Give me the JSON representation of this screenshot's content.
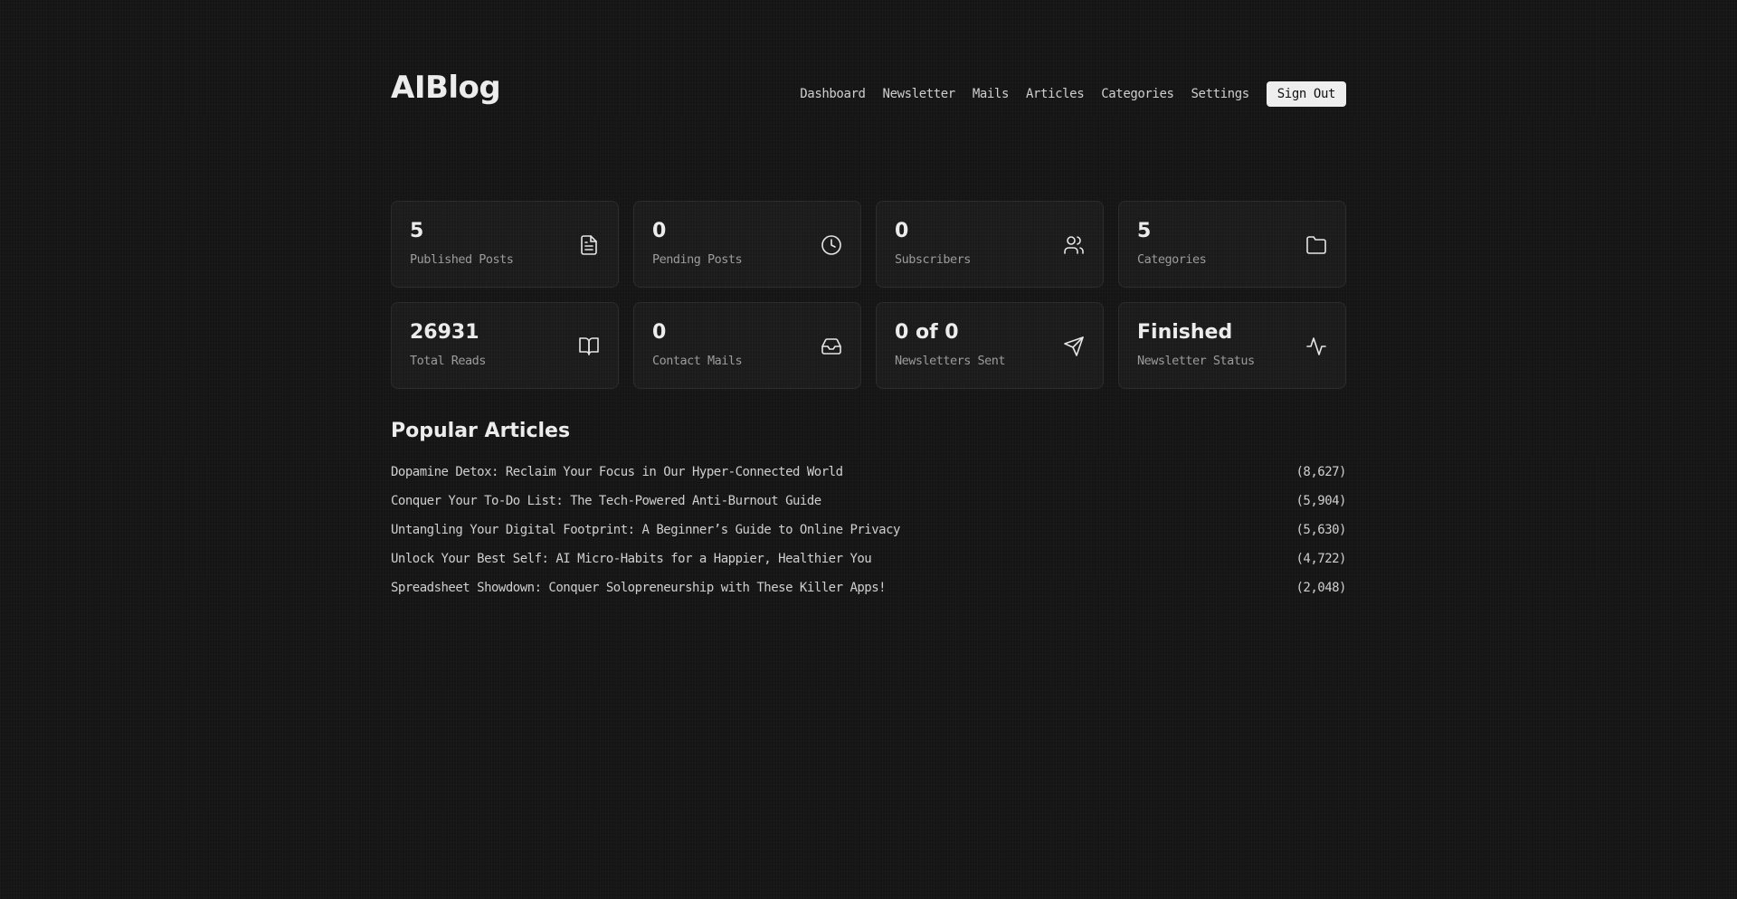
{
  "app": {
    "logo": "AIBlog"
  },
  "nav": {
    "items": [
      {
        "label": "Dashboard"
      },
      {
        "label": "Newsletter"
      },
      {
        "label": "Mails"
      },
      {
        "label": "Articles"
      },
      {
        "label": "Categories"
      },
      {
        "label": "Settings"
      }
    ],
    "signout_label": "Sign Out"
  },
  "stats": [
    {
      "value": "5",
      "label": "Published Posts",
      "icon": "document-icon"
    },
    {
      "value": "0",
      "label": "Pending Posts",
      "icon": "clock-icon"
    },
    {
      "value": "0",
      "label": "Subscribers",
      "icon": "users-icon"
    },
    {
      "value": "5",
      "label": "Categories",
      "icon": "folder-icon"
    },
    {
      "value": "26931",
      "label": "Total Reads",
      "icon": "book-open-icon"
    },
    {
      "value": "0",
      "label": "Contact Mails",
      "icon": "inbox-icon"
    },
    {
      "value": "0 of 0",
      "label": "Newsletters Sent",
      "icon": "send-icon"
    },
    {
      "value": "Finished",
      "label": "Newsletter Status",
      "icon": "activity-icon"
    }
  ],
  "popular": {
    "title": "Popular Articles",
    "articles": [
      {
        "title": "Dopamine Detox: Reclaim Your Focus in Our Hyper-Connected World",
        "count": "(8,627)"
      },
      {
        "title": "Conquer Your To-Do List: The Tech-Powered Anti-Burnout Guide",
        "count": "(5,904)"
      },
      {
        "title": "Untangling Your Digital Footprint: A Beginner’s Guide to Online Privacy",
        "count": "(5,630)"
      },
      {
        "title": "Unlock Your Best Self: AI Micro-Habits for a Happier, Healthier You",
        "count": "(4,722)"
      },
      {
        "title": "Spreadsheet Showdown: Conquer Solopreneurship with These Killer Apps!",
        "count": "(2,048)"
      }
    ]
  }
}
